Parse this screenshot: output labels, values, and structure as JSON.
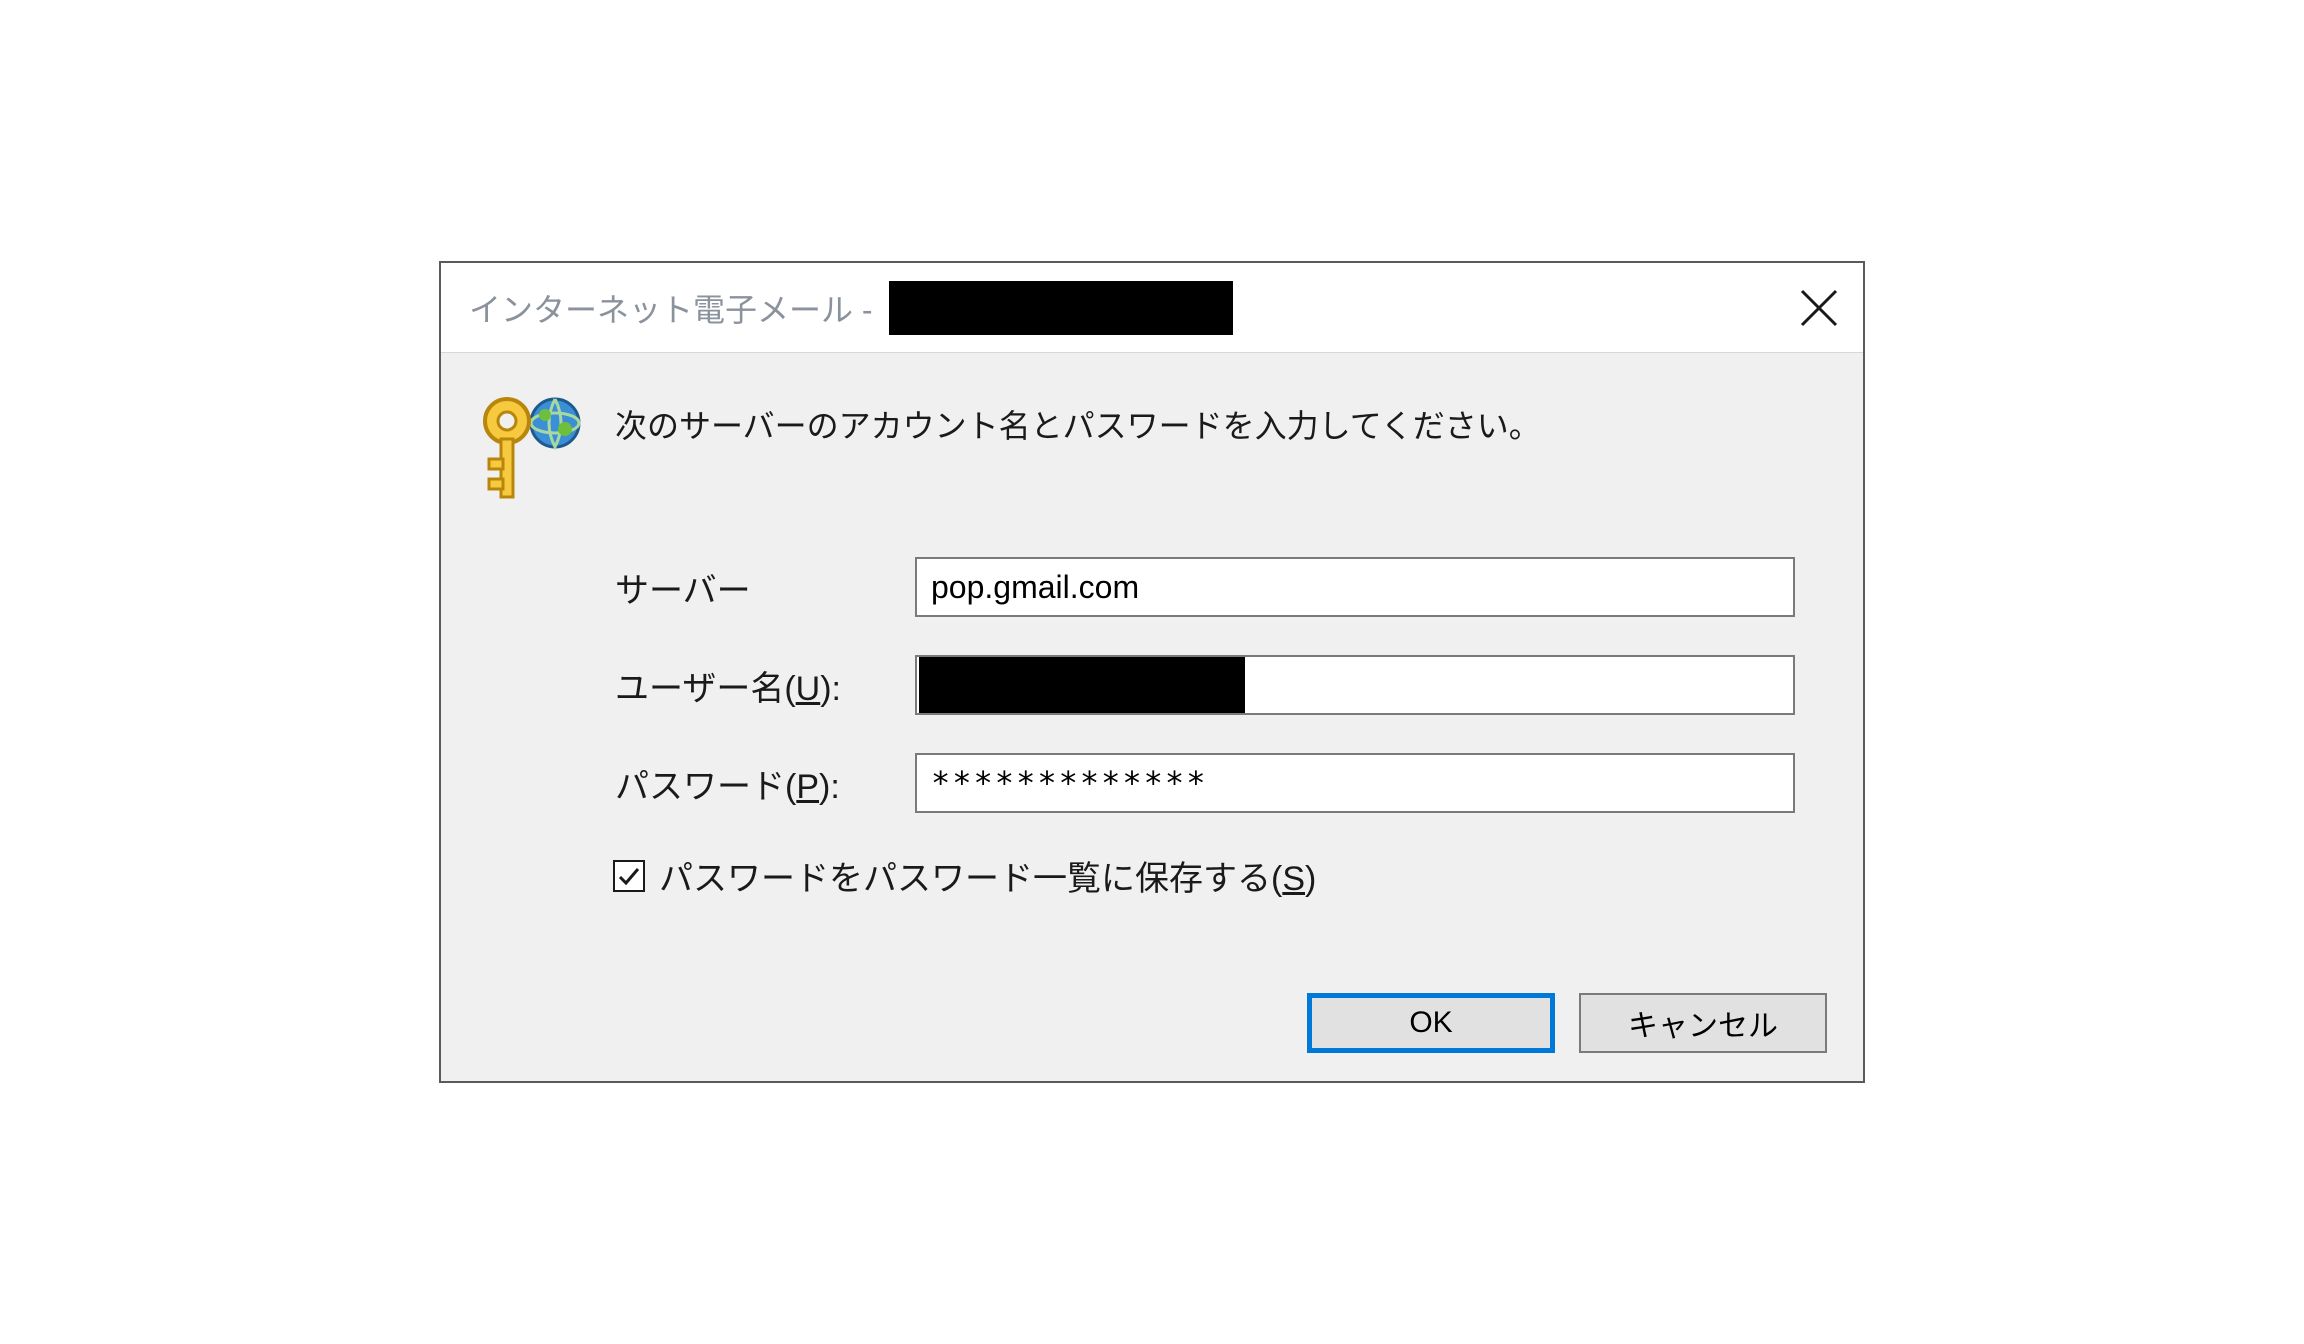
{
  "titlebar": {
    "prefix": "インターネット電子メール - "
  },
  "instruction": "次のサーバーのアカウント名とパスワードを入力してください。",
  "form": {
    "server_label": "サーバー",
    "server_value": "pop.gmail.com",
    "username_label_pre": "ユーザー名(",
    "username_ak": "U",
    "username_label_post": "):",
    "username_value": "",
    "password_label_pre": "パスワード(",
    "password_ak": "P",
    "password_label_post": "):",
    "password_value": "*************",
    "save_label_pre": "パスワードをパスワード一覧に保存する(",
    "save_ak": "S",
    "save_label_post": ")",
    "save_checked": true
  },
  "buttons": {
    "ok": "OK",
    "cancel": "キャンセル"
  }
}
